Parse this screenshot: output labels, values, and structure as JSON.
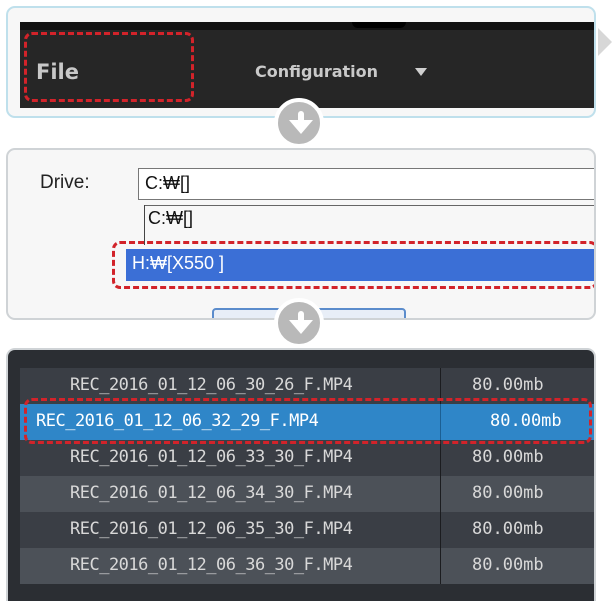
{
  "menu": {
    "file_label": "File",
    "configuration_label": "Configuration"
  },
  "drive_dialog": {
    "label": "Drive:",
    "selected_value": "C:₩[]",
    "options": [
      "C:₩[]",
      "H:₩[X550 ]"
    ],
    "highlighted_option": "H:₩[X550 ]"
  },
  "file_list": {
    "rows": [
      {
        "name": "REC_2016_01_12_06_30_26_F.MP4",
        "size": "80.00mb"
      },
      {
        "name": "REC_2016_01_12_06_32_29_F.MP4",
        "size": "80.00mb",
        "selected": true
      },
      {
        "name": "REC_2016_01_12_06_33_30_F.MP4",
        "size": "80.00mb"
      },
      {
        "name": "REC_2016_01_12_06_34_30_F.MP4",
        "size": "80.00mb"
      },
      {
        "name": "REC_2016_01_12_06_35_30_F.MP4",
        "size": "80.00mb"
      },
      {
        "name": "REC_2016_01_12_06_36_30_F.MP4",
        "size": "80.00mb"
      }
    ]
  },
  "colors": {
    "highlight_red": "#d2232a",
    "selection_blue": "#2f86c8",
    "dropdown_selection_blue": "#3b6fd6"
  }
}
